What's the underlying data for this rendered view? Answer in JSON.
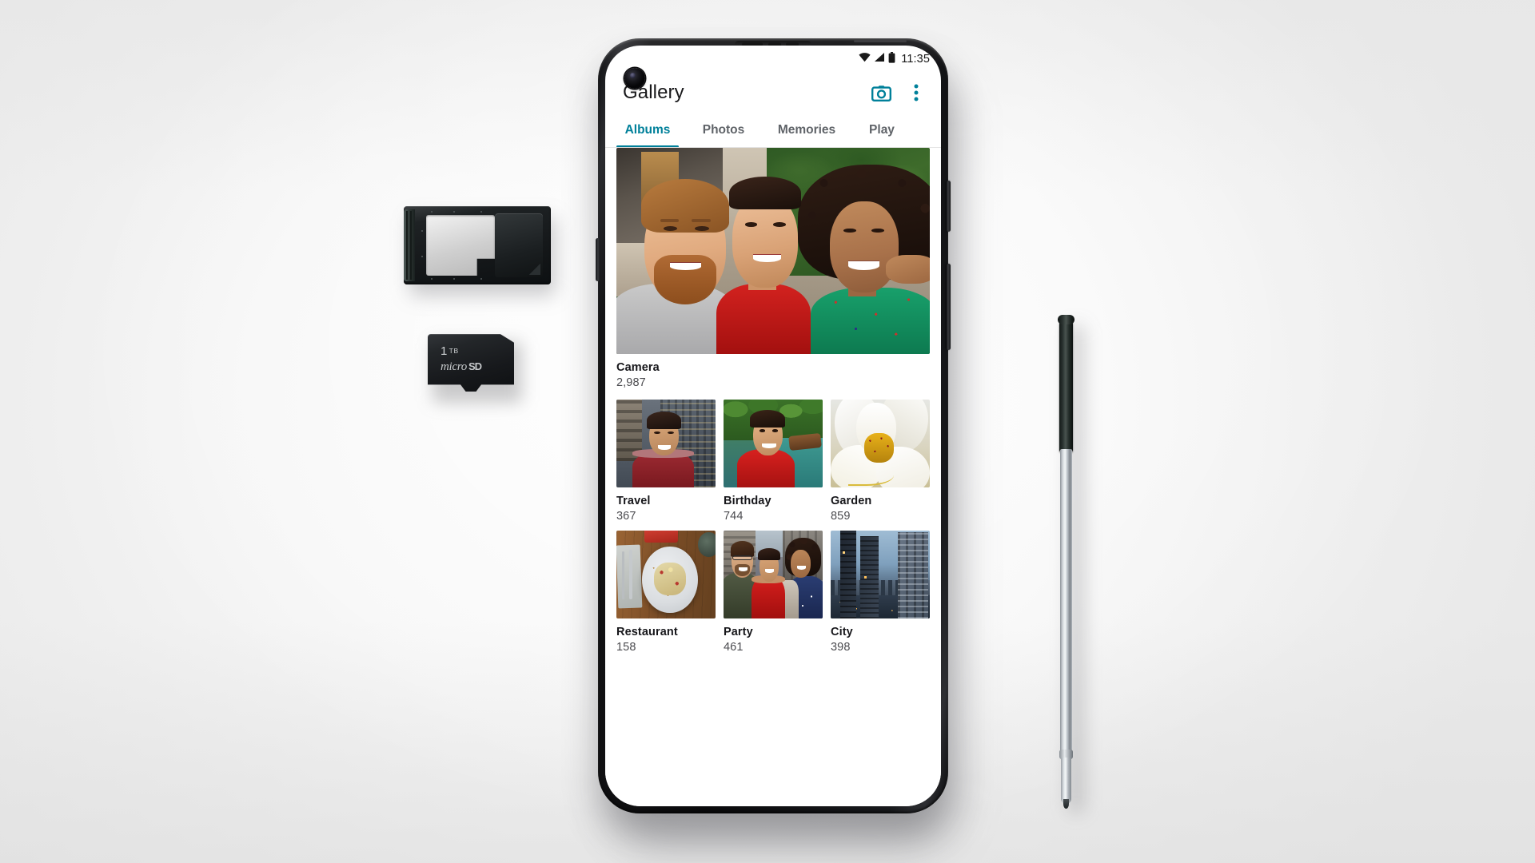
{
  "scene": {
    "description": "Smartphone on white surface showing Gallery app, with SIM/microSD tray and microSD card at left and a stylus at right",
    "background_color": "#f3f3f3"
  },
  "phone": {
    "status_bar": {
      "time": "11:35",
      "icons": [
        "wifi-icon",
        "cellular-signal-icon",
        "battery-icon"
      ]
    },
    "app_bar": {
      "title": "Gallery",
      "actions": [
        {
          "name": "camera-icon",
          "label": "Camera"
        },
        {
          "name": "overflow-menu-icon",
          "label": "More options"
        }
      ],
      "accent_color": "#00809a"
    },
    "tabs": {
      "active_index": 0,
      "items": [
        {
          "label": "Albums"
        },
        {
          "label": "Photos"
        },
        {
          "label": "Memories"
        },
        {
          "label": "Play"
        }
      ]
    },
    "featured_album": {
      "title": "Camera",
      "count": "2,987",
      "thumbnail": "three-friends-selfie-outdoors"
    },
    "albums": [
      {
        "title": "Travel",
        "count": "367",
        "thumbnail": "woman-in-red-top-city-buildings"
      },
      {
        "title": "Birthday",
        "count": "744",
        "thumbnail": "woman-in-red-dress-by-pool"
      },
      {
        "title": "Garden",
        "count": "859",
        "thumbnail": "white-magnolia-flower"
      },
      {
        "title": "Restaurant",
        "count": "158",
        "thumbnail": "plated-food-on-wooden-table"
      },
      {
        "title": "Party",
        "count": "461",
        "thumbnail": "three-friends-rooftop-selfie"
      },
      {
        "title": "City",
        "count": "398",
        "thumbnail": "skyscrapers-at-dusk"
      }
    ]
  },
  "accessories": {
    "sim_tray": {
      "name": "dual-sim-microsd-tray"
    },
    "memory_card": {
      "name": "microsd-card",
      "capacity": "1",
      "capacity_unit": "TB",
      "brand_text": "micro",
      "brand_mark": "SD"
    },
    "stylus": {
      "name": "stylus-pen"
    }
  }
}
